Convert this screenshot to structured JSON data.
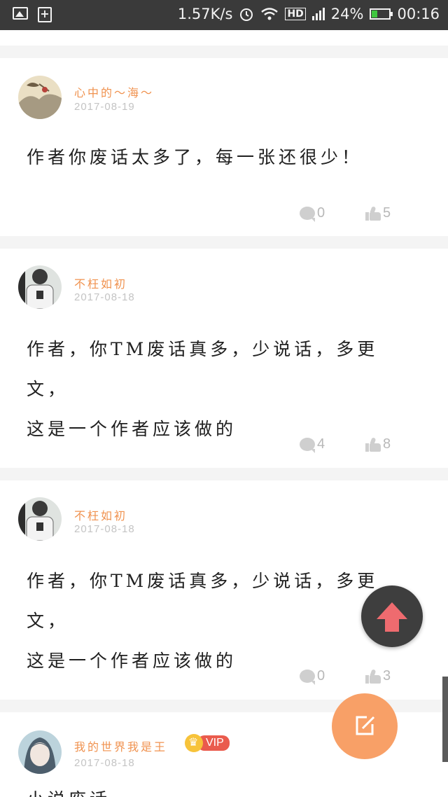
{
  "status_bar": {
    "speed": "1.57K/s",
    "network": "HD",
    "battery_percent": "24%",
    "battery_level": 0.24,
    "time": "00:16",
    "icons": [
      "image-icon",
      "add-box-icon",
      "alarm-icon",
      "wifi-icon",
      "signal-icon",
      "battery-icon"
    ]
  },
  "comments": [
    {
      "username": "心中的～海～",
      "date": "2017-08-19",
      "text_lines": [
        "作者你废话太多了，每一张还很少！"
      ],
      "comment_count": "0",
      "like_count": "5",
      "avatar": "landscape-painting-avatar"
    },
    {
      "username": "不枉如初",
      "date": "2017-08-18",
      "text_lines": [
        "作者，你TM废话真多，少说话，多更文，",
        "这是一个作者应该做的"
      ],
      "comment_count": "4",
      "like_count": "8",
      "avatar": "person-avatar"
    },
    {
      "username": "不枉如初",
      "date": "2017-08-18",
      "text_lines": [
        "作者，你TM废话真多，少说话，多更文，",
        "这是一个作者应该做的"
      ],
      "comment_count": "0",
      "like_count": "3",
      "avatar": "person-avatar"
    },
    {
      "username": "我的世界我是王",
      "date": "2017-08-18",
      "vip_label": "VIP",
      "text_lines": [
        "小说废话"
      ],
      "avatar": "anime-girl-avatar"
    }
  ],
  "buttons": {
    "scroll_top": "arrow-up-icon",
    "write_comment": "edit-icon"
  },
  "colors": {
    "username": "#f0924f",
    "fab_write": "#f8a067",
    "fab_top_arrow": "#ee6b6f",
    "vip_badge": "#ea5b4d"
  }
}
